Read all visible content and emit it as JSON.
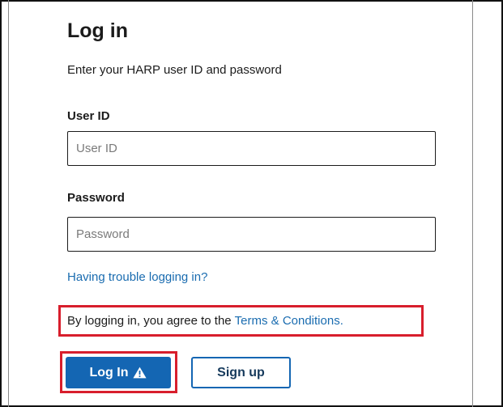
{
  "form": {
    "title": "Log in",
    "subtitle": "Enter your HARP user ID and password",
    "user_id": {
      "label": "User ID",
      "placeholder": "User ID",
      "value": ""
    },
    "password": {
      "label": "Password",
      "placeholder": "Password",
      "value": ""
    },
    "trouble_link": "Having trouble logging in?",
    "agreement": {
      "text": "By logging in, you agree to the",
      "link": "Terms & Conditions."
    },
    "buttons": {
      "login_label": "Log In",
      "login_icon": "warning-triangle-icon",
      "signup_label": "Sign up"
    }
  },
  "colors": {
    "primary": "#1466b3",
    "link": "#1a6cb0",
    "highlight": "#d81e2c",
    "text": "#1b1b1b"
  }
}
